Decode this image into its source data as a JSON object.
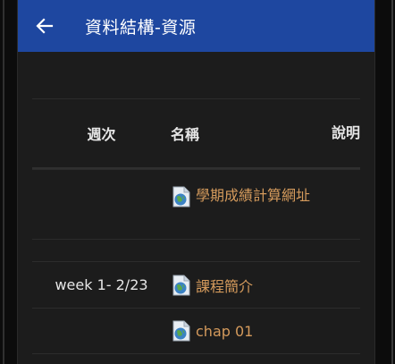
{
  "appbar": {
    "title": "資料結構-資源",
    "back_icon": "arrow-left-icon"
  },
  "table": {
    "headers": {
      "week": "週次",
      "name": "名稱",
      "desc": "說明"
    },
    "rows": [
      {
        "week": "",
        "name": "學期成績計算網址",
        "icon": "document-globe-icon"
      },
      {
        "week": "week 1- 2/23",
        "name": "課程簡介",
        "icon": "document-globe-icon"
      },
      {
        "week": "",
        "name": "chap 01",
        "icon": "document-globe-icon"
      }
    ]
  },
  "colors": {
    "appbar": "#1e47a0",
    "background": "#1c1c1c",
    "link": "#d49a5c",
    "text": "#e6e6e6"
  }
}
